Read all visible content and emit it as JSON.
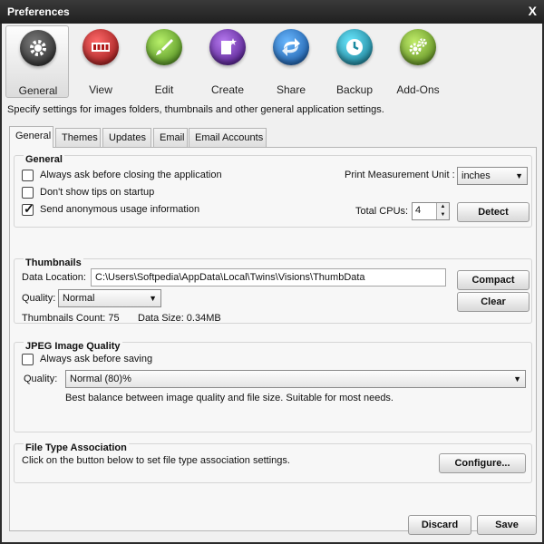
{
  "window": {
    "title": "Preferences"
  },
  "toolbar": {
    "items": [
      {
        "label": "General",
        "color": "#4a4a4a"
      },
      {
        "label": "View",
        "color": "#c42222"
      },
      {
        "label": "Edit",
        "color": "#6cae2a"
      },
      {
        "label": "Create",
        "color": "#6a2aa8"
      },
      {
        "label": "Share",
        "color": "#1e78c8"
      },
      {
        "label": "Backup",
        "color": "#1aa0b8"
      },
      {
        "label": "Add-Ons",
        "color": "#6a9a2a"
      }
    ]
  },
  "description": "Specify settings for images folders, thumbnails and other general application settings.",
  "tabs": [
    "General",
    "Themes",
    "Updates",
    "Email",
    "Email Accounts"
  ],
  "general": {
    "title": "General",
    "ask_close": {
      "label": "Always ask before closing the application",
      "checked": false
    },
    "no_tips": {
      "label": "Don't show tips on startup",
      "checked": false
    },
    "usage": {
      "label": "Send anonymous usage information",
      "checked": true
    },
    "print_unit_label": "Print Measurement Unit :",
    "print_unit_value": "inches",
    "cpus_label": "Total CPUs:",
    "cpus_value": "4",
    "detect_label": "Detect"
  },
  "thumbnails": {
    "title": "Thumbnails",
    "data_location_label": "Data Location:",
    "data_location_value": "C:\\Users\\Softpedia\\AppData\\Local\\Twins\\Visions\\ThumbData",
    "quality_label": "Quality:",
    "quality_value": "Normal",
    "count_text": "Thumbnails Count: 75",
    "size_text": "Data Size: 0.34MB",
    "compact_label": "Compact",
    "clear_label": "Clear"
  },
  "jpeg": {
    "title": "JPEG Image Quality",
    "ask_save": {
      "label": "Always ask before saving",
      "checked": false
    },
    "quality_label": "Quality:",
    "quality_value": "Normal (80)%",
    "hint": "Best balance between image quality and file size. Suitable for most needs."
  },
  "filetype": {
    "title": "File Type Association",
    "text": "Click on the button below to set file type association settings.",
    "configure_label": "Configure..."
  },
  "footer": {
    "discard_label": "Discard",
    "save_label": "Save"
  },
  "icons": {
    "close": "X",
    "tick": "✓",
    "dropdown": "▼",
    "spin_up": "▲",
    "spin_down": "▼"
  }
}
